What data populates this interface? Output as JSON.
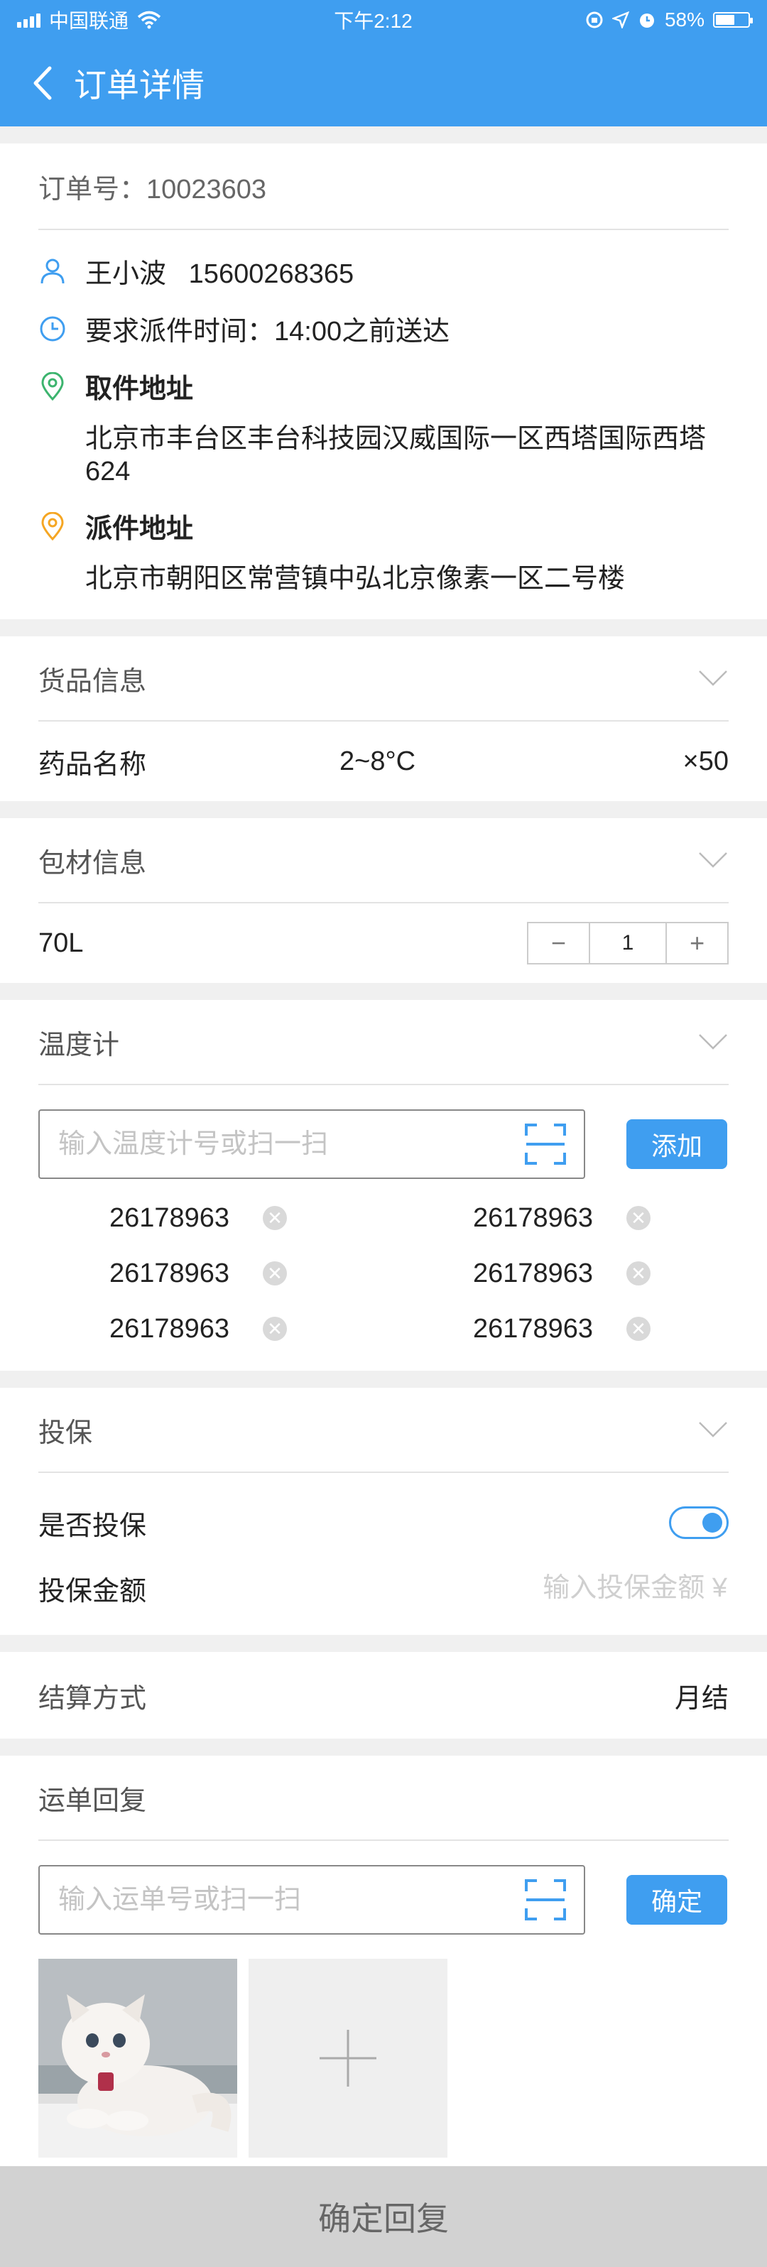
{
  "status_bar": {
    "carrier": "中国联通",
    "time": "下午2:12",
    "battery": "58%",
    "battery_level": 0.58
  },
  "header": {
    "title": "订单详情"
  },
  "order": {
    "number_label": "订单号：10023603",
    "customer": "王小波   15600268365",
    "deadline": "要求派件时间：14:00之前送达",
    "pickup_label": "取件地址",
    "pickup_address": "北京市丰台区丰台科技园汉威国际一区西塔国际西塔624",
    "delivery_label": "派件地址",
    "delivery_address": "北京市朝阳区常营镇中弘北京像素一区二号楼"
  },
  "goods": {
    "title": "货品信息",
    "name": "药品名称",
    "temp": "2~8°C",
    "qty": "×50"
  },
  "packaging": {
    "title": "包材信息",
    "item": "70L",
    "minus": "−",
    "value": "1",
    "plus": "+"
  },
  "thermometer": {
    "title": "温度计",
    "placeholder": "输入温度计号或扫一扫",
    "add_label": "添加",
    "items": [
      "26178963",
      "26178963",
      "26178963",
      "26178963",
      "26178963",
      "26178963"
    ]
  },
  "insurance": {
    "title": "投保",
    "toggle_label": "是否投保",
    "toggle_on": true,
    "amount_label": "投保金额",
    "amount_placeholder": "输入投保金额 ¥"
  },
  "settlement": {
    "label": "结算方式",
    "value": "月结"
  },
  "waybill": {
    "title": "运单回复",
    "placeholder": "输入运单号或扫一扫",
    "confirm_label": "确定"
  },
  "footer": {
    "submit_label": "确定回复"
  },
  "colors": {
    "primary": "#3f9ef0",
    "pickup_icon": "#3cb46e",
    "delivery_icon": "#f5a623"
  },
  "icons": [
    "user-icon",
    "clock-icon",
    "location-pin-icon",
    "scan-icon",
    "close-icon",
    "chevron-down-icon",
    "plus-icon"
  ]
}
